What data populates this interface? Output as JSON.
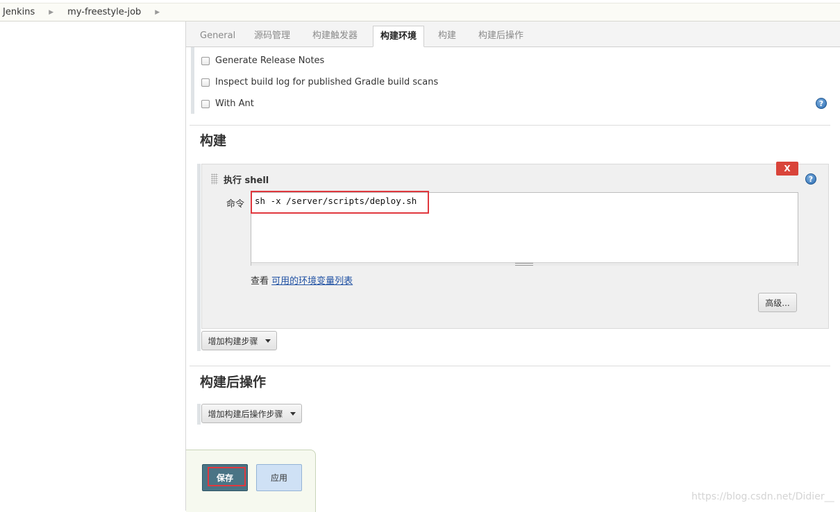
{
  "breadcrumb": {
    "items": [
      "Jenkins",
      "my-freestyle-job"
    ]
  },
  "tabs": [
    {
      "label": "General",
      "active": false
    },
    {
      "label": "源码管理",
      "active": false
    },
    {
      "label": "构建触发器",
      "active": false
    },
    {
      "label": "构建环境",
      "active": true
    },
    {
      "label": "构建",
      "active": false
    },
    {
      "label": "构建后操作",
      "active": false
    }
  ],
  "build_environment": {
    "options": [
      {
        "label": "Generate Release Notes",
        "checked": false
      },
      {
        "label": "Inspect build log for published Gradle build scans",
        "checked": false
      },
      {
        "label": "With Ant",
        "checked": false
      }
    ]
  },
  "build_section": {
    "title": "构建",
    "step": {
      "title": "执行 shell",
      "delete_label": "X",
      "command_label": "命令",
      "command_value": "sh -x /server/scripts/deploy.sh",
      "env_prefix": "查看",
      "env_link": "可用的环境变量列表",
      "advanced_label": "高级..."
    },
    "add_step_label": "增加构建步骤"
  },
  "post_build_section": {
    "title": "构建后操作",
    "add_step_label": "增加构建后操作步骤"
  },
  "actions": {
    "save_label": "保存",
    "apply_label": "应用"
  },
  "help_icon_glyph": "?",
  "watermark": "https://blog.csdn.net/Didier__",
  "colors": {
    "save_button": "#4a7485",
    "apply_button": "#cfe1f5",
    "delete_button": "#d9443a",
    "link": "#2051a3",
    "highlight": "#e0383e"
  }
}
